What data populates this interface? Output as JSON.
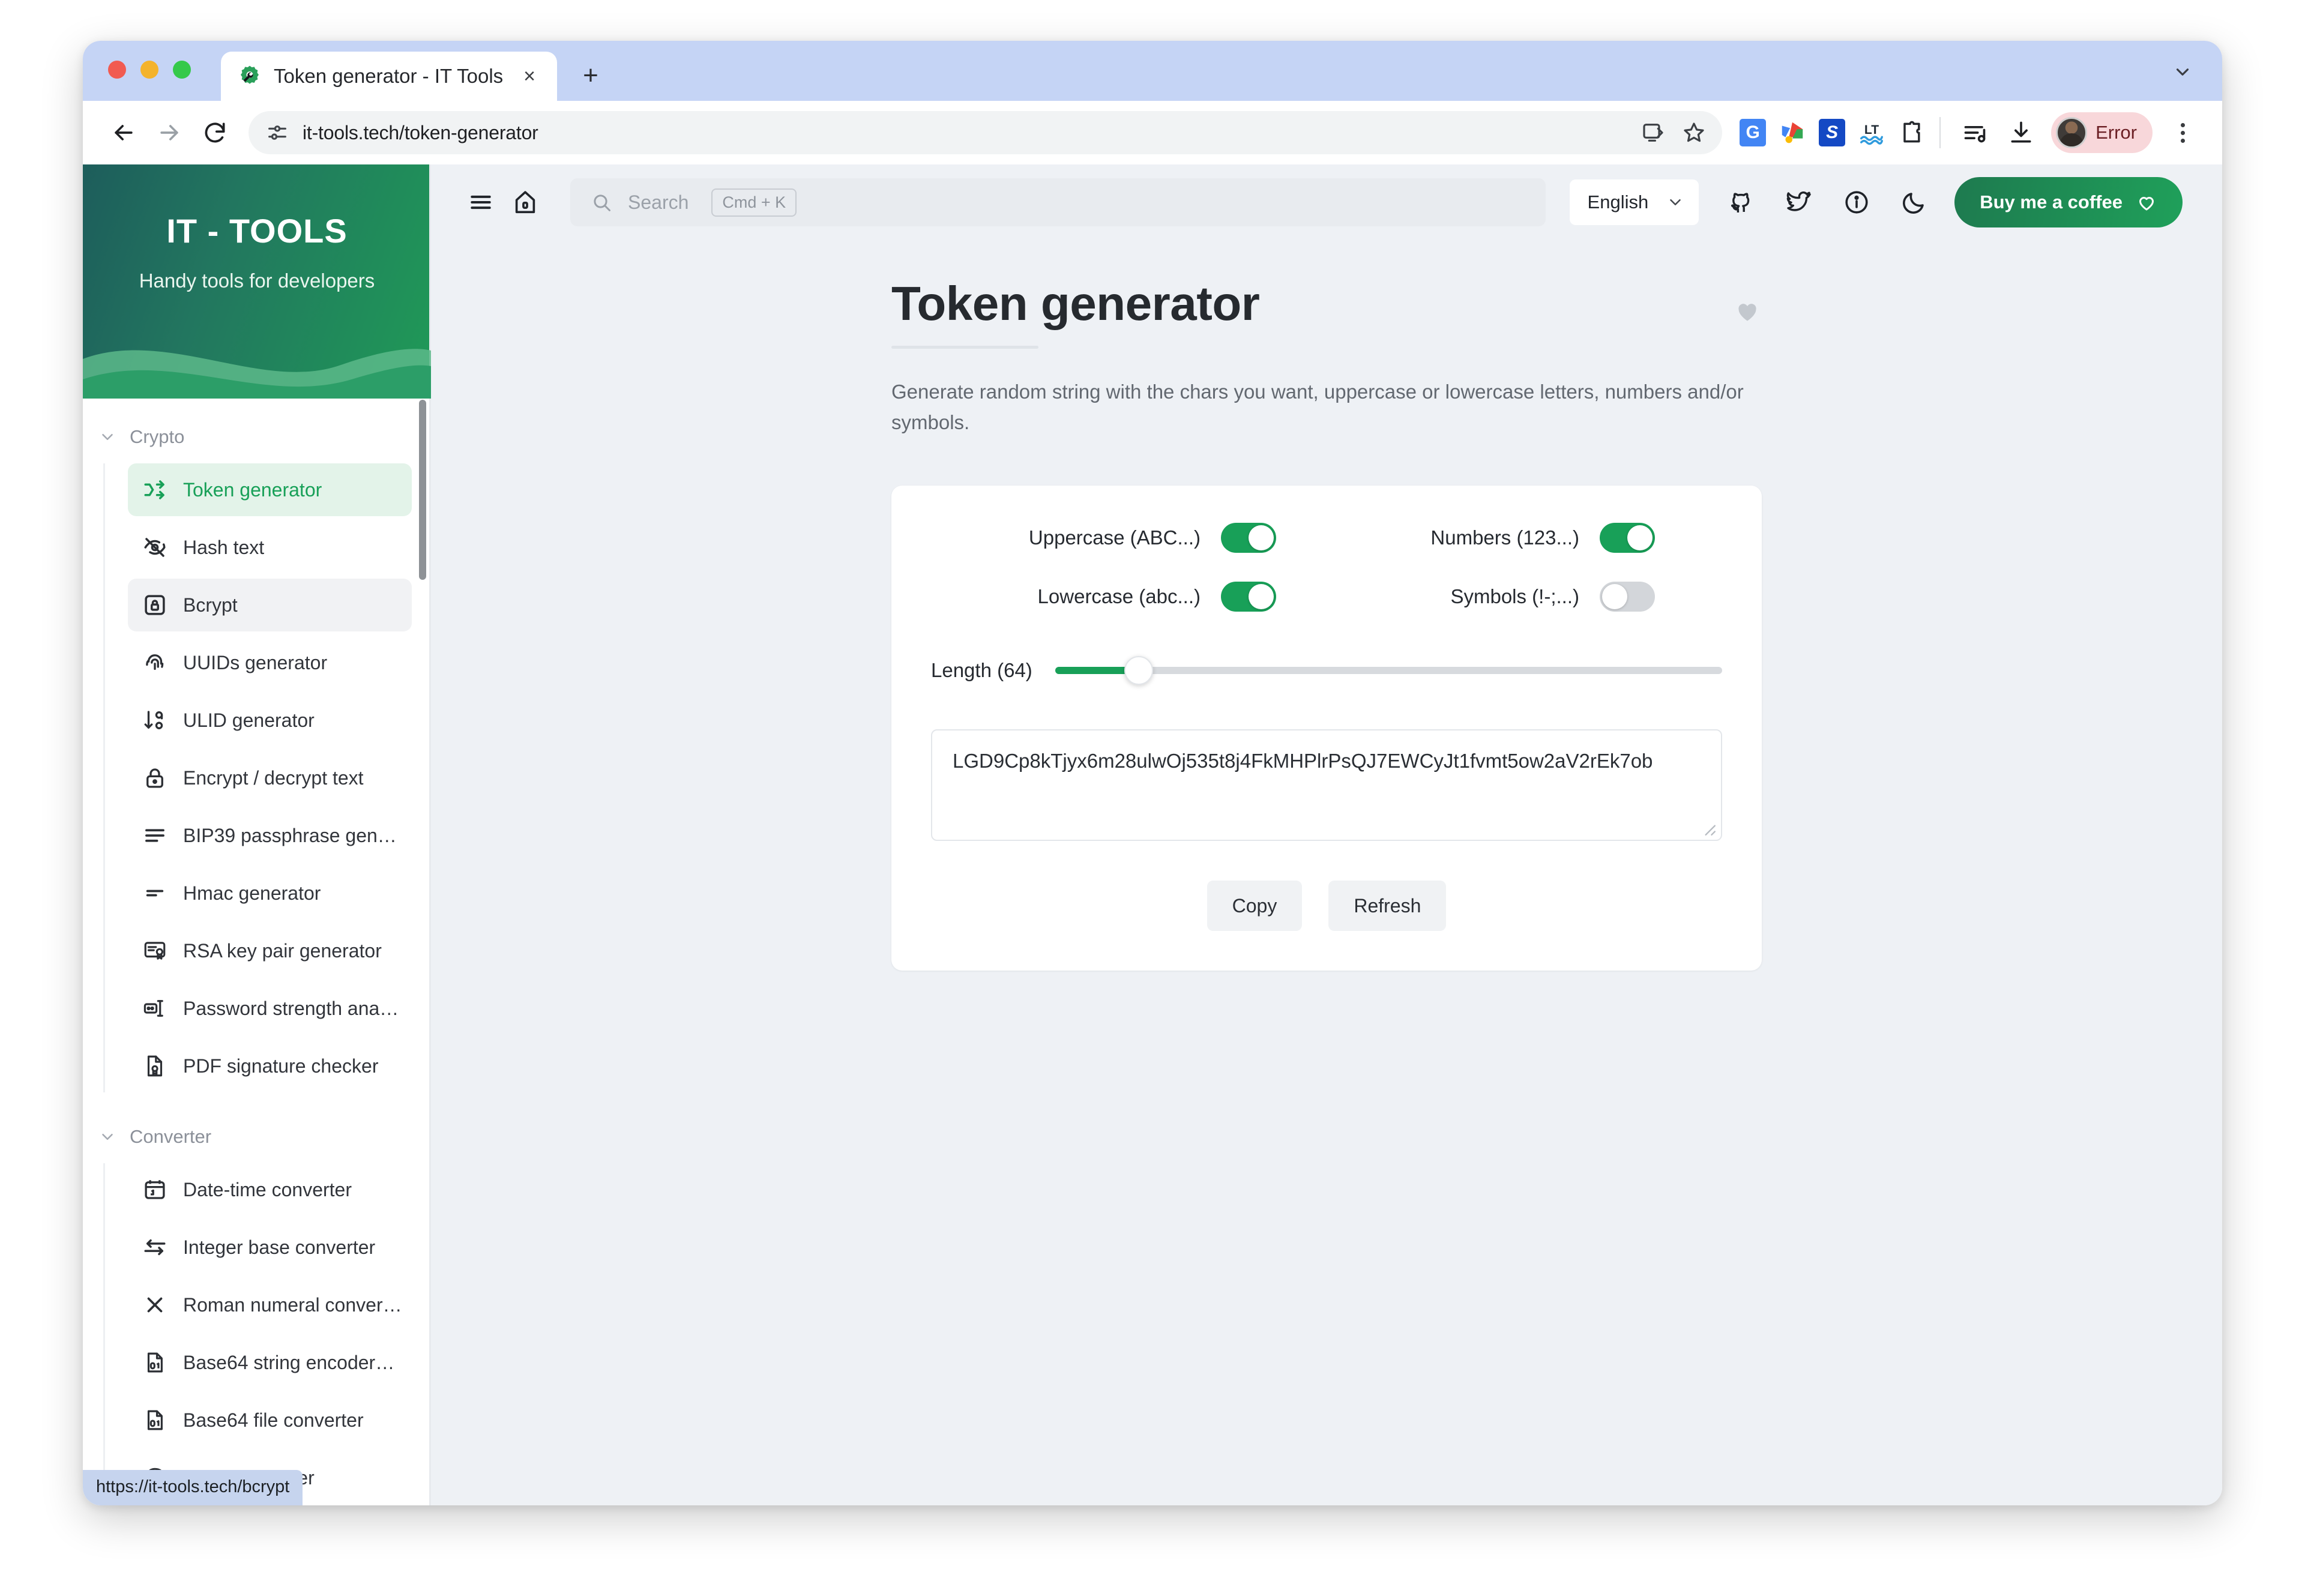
{
  "browser": {
    "tab": {
      "title": "Token generator - IT Tools",
      "favicon": "wrench-gear-icon",
      "close": "×"
    },
    "new_tab_label": "+",
    "url": "it-tools.tech/token-generator",
    "profile_label": "Error",
    "extensions": [
      {
        "name": "google-translate-icon",
        "letter": "G",
        "color": "#4285f4"
      },
      {
        "name": "google-colorful-icon",
        "letter": "",
        "color": "#ffffff"
      },
      {
        "name": "scribe-s-icon",
        "letter": "S",
        "color": "#1449c4"
      },
      {
        "name": "languagetool-icon",
        "letter": "LT",
        "color": "#ffffff"
      },
      {
        "name": "extension-puzzle-icon",
        "letter": "",
        "color": "#ffffff"
      }
    ],
    "status_link": "https://it-tools.tech/bcrypt"
  },
  "sidebar": {
    "brand": {
      "title": "IT - TOOLS",
      "subtitle": "Handy tools for developers"
    },
    "groups": [
      {
        "label": "Crypto",
        "items": [
          {
            "label": "Token generator",
            "icon": "shuffle-icon",
            "state": "active"
          },
          {
            "label": "Hash text",
            "icon": "eye-off-icon",
            "state": "normal"
          },
          {
            "label": "Bcrypt",
            "icon": "lock-square-icon",
            "state": "hover"
          },
          {
            "label": "UUIDs generator",
            "icon": "fingerprint-icon",
            "state": "normal"
          },
          {
            "label": "ULID generator",
            "icon": "sort-numeric-icon",
            "state": "normal"
          },
          {
            "label": "Encrypt / decrypt text",
            "icon": "padlock-icon",
            "state": "normal"
          },
          {
            "label": "BIP39 passphrase gen…",
            "icon": "lines-icon",
            "state": "normal"
          },
          {
            "label": "Hmac generator",
            "icon": "two-lines-icon",
            "state": "normal"
          },
          {
            "label": "RSA key pair generator",
            "icon": "certificate-icon",
            "state": "normal"
          },
          {
            "label": "Password strength ana…",
            "icon": "password-meter-icon",
            "state": "normal"
          },
          {
            "label": "PDF signature checker",
            "icon": "file-badge-icon",
            "state": "normal"
          }
        ]
      },
      {
        "label": "Converter",
        "items": [
          {
            "label": "Date-time converter",
            "icon": "calendar-icon",
            "state": "normal"
          },
          {
            "label": "Integer base converter",
            "icon": "arrows-exchange-icon",
            "state": "normal"
          },
          {
            "label": "Roman numeral conver…",
            "icon": "roman-x-icon",
            "state": "normal"
          },
          {
            "label": "Base64 string encoder…",
            "icon": "file-binary-icon",
            "state": "normal"
          },
          {
            "label": "Base64 file converter",
            "icon": "file-binary-icon",
            "state": "normal"
          },
          {
            "label": "Color converter",
            "icon": "palette-icon",
            "state": "normal"
          }
        ]
      }
    ]
  },
  "appbar": {
    "menu_icon": "hamburger-icon",
    "home_icon": "home-icon",
    "search": {
      "placeholder": "Search",
      "shortcut": "Cmd + K"
    },
    "language": "English",
    "icons": [
      "github-icon",
      "twitter-icon",
      "info-icon",
      "dark-mode-icon"
    ],
    "coffee_button": "Buy me a coffee"
  },
  "main": {
    "title": "Token generator",
    "description": "Generate random string with the chars you want, uppercase or lowercase letters, numbers and/or symbols.",
    "favorite_icon": "heart-icon",
    "options": [
      {
        "label": "Uppercase (ABC...)",
        "on": true
      },
      {
        "label": "Numbers (123...)",
        "on": true
      },
      {
        "label": "Lowercase (abc...)",
        "on": true
      },
      {
        "label": "Symbols (!-;...)",
        "on": false
      }
    ],
    "length": {
      "label": "Length (64)",
      "value": 64,
      "min": 0,
      "max": 512,
      "percent": 12.5
    },
    "token": "LGD9Cp8kTjyx6m28ulwOj535t8j4FkMHPlrPsQJ7EWCyJt1fvmt5ow2aV2rEk7ob",
    "buttons": {
      "copy": "Copy",
      "refresh": "Refresh"
    }
  },
  "colors": {
    "accent_green": "#18a058",
    "brand_dark": "#1d5d5b",
    "tabstrip": "#c5d4f5",
    "page_bg": "#eef1f5",
    "error_pill": "#f8d7da"
  }
}
